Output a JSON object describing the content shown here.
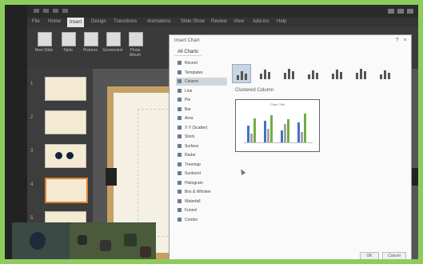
{
  "app": {
    "title_text": "",
    "tabs": [
      "File",
      "Home",
      "Insert",
      "Design",
      "Transitions",
      "Animations",
      "Slide Show",
      "Review",
      "View",
      "Add-ins",
      "Help"
    ],
    "active_tab_index": 2
  },
  "ribbon": {
    "buttons": [
      {
        "label": "New Slide",
        "icon": "new-slide-icon"
      },
      {
        "label": "Table",
        "icon": "table-icon"
      },
      {
        "label": "Pictures",
        "icon": "pictures-icon"
      },
      {
        "label": "Screenshot",
        "icon": "screenshot-icon"
      },
      {
        "label": "Photo Album",
        "icon": "photo-album-icon"
      }
    ]
  },
  "slides": [
    {
      "number": "1"
    },
    {
      "number": "2"
    },
    {
      "number": "3"
    },
    {
      "number": "4"
    },
    {
      "number": "5"
    }
  ],
  "selected_slide": 4,
  "dialog": {
    "title": "Insert Chart",
    "tab": "All Charts",
    "categories": [
      "Recent",
      "Templates",
      "Column",
      "Line",
      "Pie",
      "Bar",
      "Area",
      "X Y (Scatter)",
      "Stock",
      "Surface",
      "Radar",
      "Treemap",
      "Sunburst",
      "Histogram",
      "Box & Whisker",
      "Waterfall",
      "Funnel",
      "Combo"
    ],
    "selected_category": "Column",
    "chart_type_icons": [
      "clustered-column-icon",
      "stacked-column-icon",
      "100-stacked-column-icon",
      "3d-clustered-column-icon",
      "3d-stacked-column-icon",
      "3d-100-stacked-column-icon",
      "3d-column-icon"
    ],
    "selected_type_index": 0,
    "subtype_label": "Clustered Column",
    "preview_title": "Chart Title",
    "ok_label": "OK",
    "cancel_label": "Cancel"
  },
  "preview_chart": {
    "series_colors": [
      "#4472c4",
      "#a5a5a5",
      "#70ad47"
    ],
    "groups": [
      [
        0.55,
        0.3,
        0.8
      ],
      [
        0.7,
        0.45,
        0.9
      ],
      [
        0.4,
        0.6,
        0.75
      ],
      [
        0.65,
        0.35,
        0.95
      ]
    ]
  },
  "colors": {
    "accent": "#e0822d",
    "slide_border": "#c5a065",
    "outer_background": "#8ecb5d"
  }
}
